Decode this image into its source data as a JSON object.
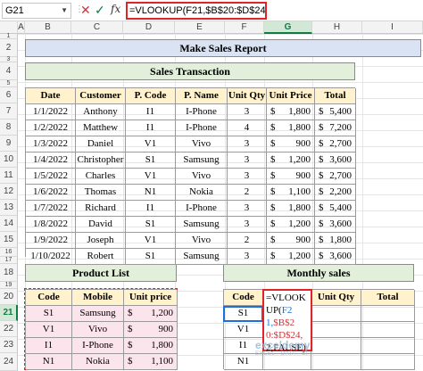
{
  "name_box": "G21",
  "formula": "=VLOOKUP(F21,$B$20:$D$24,2,FALSE)",
  "fx_label": "fx",
  "columns": [
    "A",
    "B",
    "C",
    "D",
    "E",
    "F",
    "G",
    "H",
    "I"
  ],
  "rows": [
    "1",
    "2",
    "3",
    "4",
    "5",
    "6",
    "7",
    "8",
    "9",
    "10",
    "11",
    "12",
    "13",
    "14",
    "15",
    "16",
    "17",
    "18",
    "19",
    "20",
    "21",
    "22",
    "23",
    "24"
  ],
  "titles": {
    "main": "Make Sales Report",
    "sales": "Sales Transaction",
    "product": "Product List",
    "monthly": "Monthly sales"
  },
  "sales_table": {
    "headers": [
      "Date",
      "Customer",
      "P. Code",
      "P. Name",
      "Unit Qty",
      "Unit Price",
      "Total"
    ],
    "rows": [
      [
        "1/1/2022",
        "Anthony",
        "I1",
        "I-Phone",
        "3",
        "$",
        "1,800",
        "$",
        "5,400"
      ],
      [
        "1/2/2022",
        "Matthew",
        "I1",
        "I-Phone",
        "4",
        "$",
        "1,800",
        "$",
        "7,200"
      ],
      [
        "1/3/2022",
        "Daniel",
        "V1",
        "Vivo",
        "3",
        "$",
        "900",
        "$",
        "2,700"
      ],
      [
        "1/4/2022",
        "Christopher",
        "S1",
        "Samsung",
        "3",
        "$",
        "1,200",
        "$",
        "3,600"
      ],
      [
        "1/5/2022",
        "Charles",
        "V1",
        "Vivo",
        "3",
        "$",
        "900",
        "$",
        "2,700"
      ],
      [
        "1/6/2022",
        "Thomas",
        "N1",
        "Nokia",
        "2",
        "$",
        "1,100",
        "$",
        "2,200"
      ],
      [
        "1/7/2022",
        "Richard",
        "I1",
        "I-Phone",
        "3",
        "$",
        "1,800",
        "$",
        "5,400"
      ],
      [
        "1/8/2022",
        "David",
        "S1",
        "Samsung",
        "3",
        "$",
        "1,200",
        "$",
        "3,600"
      ],
      [
        "1/9/2022",
        "Joseph",
        "V1",
        "Vivo",
        "2",
        "$",
        "900",
        "$",
        "1,800"
      ],
      [
        "1/10/2022",
        "Robert",
        "S1",
        "Samsung",
        "3",
        "$",
        "1,200",
        "$",
        "3,600"
      ]
    ]
  },
  "product_table": {
    "headers": [
      "Code",
      "Mobile",
      "Unit price"
    ],
    "rows": [
      [
        "S1",
        "Samsung",
        "$",
        "1,200"
      ],
      [
        "V1",
        "Vivo",
        "$",
        "900"
      ],
      [
        "I1",
        "I-Phone",
        "$",
        "1,800"
      ],
      [
        "N1",
        "Nokia",
        "$",
        "1,100"
      ]
    ]
  },
  "monthly_table": {
    "headers": [
      "Code",
      "Mobile",
      "Unit Qty",
      "Total"
    ],
    "codes": [
      "S1",
      "V1",
      "I1",
      "N1"
    ]
  },
  "overlay": {
    "line1": "=VLOOKUP(",
    "f21": "F21,",
    "range": "$B$20:$",
    "range2": "D$24,",
    "rest": "2,FALS",
    "end": "E)"
  },
  "watermark": {
    "name": "exceldemy",
    "tagline": "EXCEL · DATA · BI"
  }
}
